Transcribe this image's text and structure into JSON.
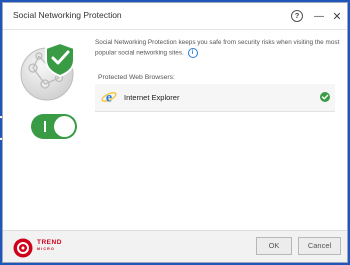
{
  "window": {
    "title": "Social Networking Protection",
    "help_label": "?",
    "minimize_label": "—",
    "close_label": "✕"
  },
  "main": {
    "description": "Social Networking Protection keeps you safe from security risks when visiting the most popular social networking sites.",
    "info_label": "i",
    "browsers_label": "Protected Web Browsers:",
    "browsers": [
      {
        "name": "Internet Explorer",
        "icon": "ie-icon",
        "status_icon": "check-icon"
      }
    ],
    "protection_enabled": true
  },
  "footer": {
    "logo_text": "TREND",
    "logo_subtext": "MICRO",
    "ok_label": "OK",
    "cancel_label": "Cancel"
  },
  "colors": {
    "background": "#1f56b8",
    "accent_green": "#3a9b45",
    "brand_red": "#d0021b",
    "ie_blue": "#2a7ad9"
  }
}
